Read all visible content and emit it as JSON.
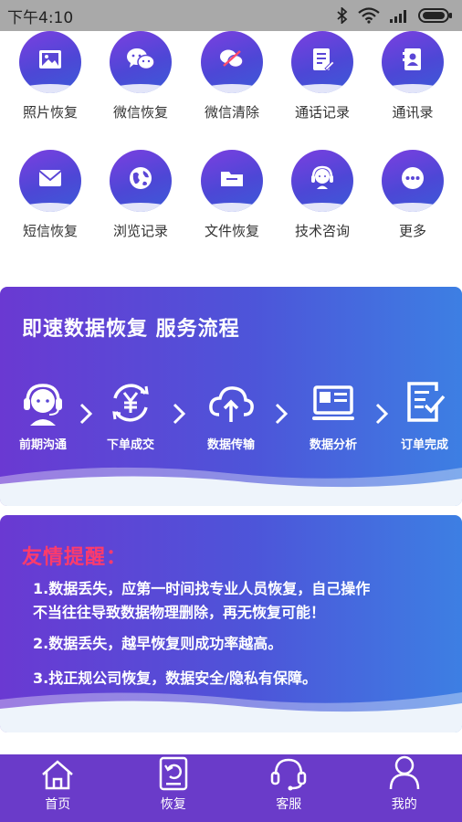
{
  "status_bar": {
    "time": "下午4:10"
  },
  "grid": {
    "row1": [
      {
        "label": "照片恢复",
        "icon": "photo-icon"
      },
      {
        "label": "微信恢复",
        "icon": "wechat-icon"
      },
      {
        "label": "微信清除",
        "icon": "wechat-clear-icon"
      },
      {
        "label": "通话记录",
        "icon": "call-log-icon"
      },
      {
        "label": "通讯录",
        "icon": "contacts-icon"
      }
    ],
    "row2": [
      {
        "label": "短信恢复",
        "icon": "sms-icon"
      },
      {
        "label": "浏览记录",
        "icon": "browser-history-icon"
      },
      {
        "label": "文件恢复",
        "icon": "folder-icon"
      },
      {
        "label": "技术咨询",
        "icon": "support-icon"
      },
      {
        "label": "更多",
        "icon": "more-icon"
      }
    ]
  },
  "process": {
    "title": "即速数据恢复 服务流程",
    "steps": [
      {
        "label": "前期沟通",
        "icon": "headset-icon"
      },
      {
        "label": "下单成交",
        "icon": "yuan-cycle-icon"
      },
      {
        "label": "数据传输",
        "icon": "cloud-upload-icon"
      },
      {
        "label": "数据分析",
        "icon": "monitor-analysis-icon"
      },
      {
        "label": "订单完成",
        "icon": "document-check-icon"
      }
    ]
  },
  "reminder": {
    "title": "友情提醒：",
    "item1_line1": "1.数据丢失，应第一时间找专业人员恢复，自己操作",
    "item1_line2": "不当往往导致数据物理删除，再无恢复可能！",
    "item2": "2.数据丢失，越早恢复则成功率越高。",
    "item3": "3.找正规公司恢复，数据安全/隐私有保障。"
  },
  "nav": {
    "items": [
      {
        "label": "首页",
        "icon": "home-icon"
      },
      {
        "label": "恢复",
        "icon": "recover-icon"
      },
      {
        "label": "客服",
        "icon": "customer-service-icon"
      },
      {
        "label": "我的",
        "icon": "profile-icon"
      }
    ]
  },
  "colors": {
    "primary_purple": "#6a3bc9",
    "gradient_start": "#6a39d2",
    "gradient_end": "#3d7fe3",
    "reminder_title": "#ff3b6b",
    "status_bar": "#a9a9a9"
  }
}
